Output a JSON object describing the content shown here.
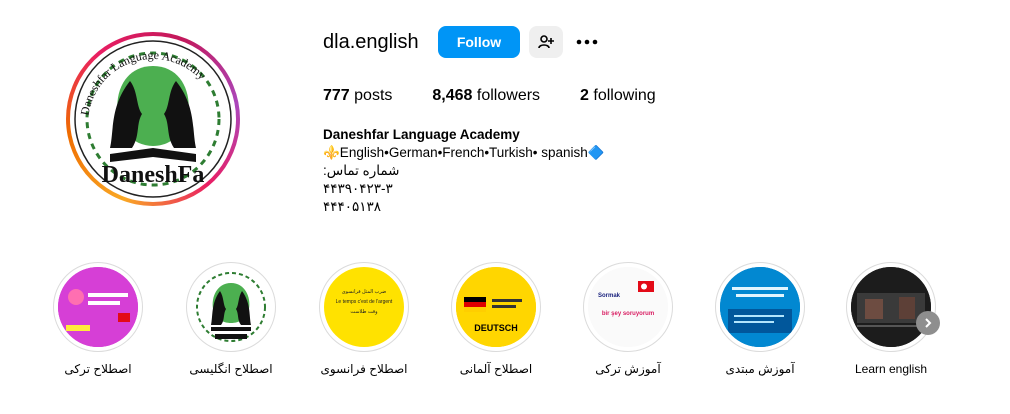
{
  "profile": {
    "username": "dla.english",
    "follow_label": "Follow",
    "add_user_icon": "person-add-icon",
    "more_icon": "more-horizontal-icon",
    "avatar_text_top": "Daneshfar Language Academy",
    "avatar_text_bottom": "DaneshFa"
  },
  "stats": {
    "posts_count": "777",
    "posts_label": "posts",
    "followers_count": "8,468",
    "followers_label": "followers",
    "following_count": "2",
    "following_label": "following"
  },
  "bio": {
    "name": "Daneshfar Language Academy",
    "languages": "⚜️English•German•French•Turkish• spanish🔷",
    "contact_label": "شماره تماس:",
    "phone1": "۴۴۳۹۰۴۲۳-۳",
    "phone2": "۴۴۴۰۵۱۳۸"
  },
  "highlights": [
    {
      "label": "اصطلاح ترکی",
      "icon": "turkish-idioms-thumbnail"
    },
    {
      "label": "اصطلاح انگلیسی",
      "icon": "academy-logo-thumbnail"
    },
    {
      "label": "اصطلاح فرانسوی",
      "icon": "french-idioms-thumbnail",
      "thumb_text_1": "ضرب المثل فرانسوی",
      "thumb_text_2": "Le temps c'est de l'argent",
      "thumb_text_3": "وقت طلاست"
    },
    {
      "label": "اصطلاح آلمانی",
      "icon": "german-idioms-thumbnail",
      "thumb_text_1": "DEUTSCH"
    },
    {
      "label": "آموزش ترکی",
      "icon": "turkish-lesson-thumbnail",
      "thumb_text_1": "Sormak",
      "thumb_text_2": "bir şey soruyorum"
    },
    {
      "label": "آموزش مبتدی",
      "icon": "beginner-lesson-thumbnail"
    },
    {
      "label": "Learn english",
      "icon": "learn-english-thumbnail"
    }
  ],
  "colors": {
    "follow_blue": "#0095f6",
    "story_gradient": [
      "#f9a825",
      "#e91e63",
      "#ab47bc"
    ]
  }
}
